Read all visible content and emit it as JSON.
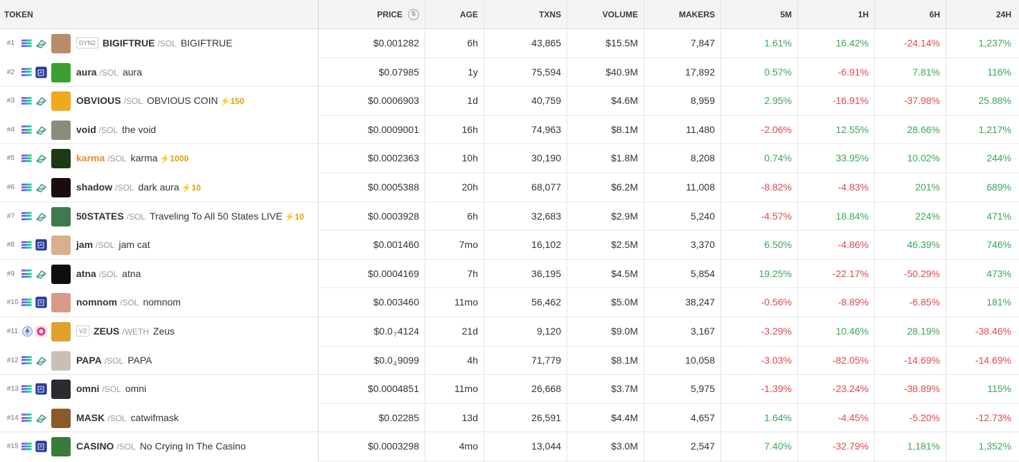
{
  "headers": {
    "token": "TOKEN",
    "price": "PRICE",
    "age": "AGE",
    "txns": "TXNS",
    "volume": "VOLUME",
    "makers": "MAKERS",
    "m5": "5M",
    "h1": "1H",
    "h6": "6H",
    "h24": "24H"
  },
  "price_icon": "dollar-circle-icon",
  "colors": {
    "positive": "#3aa65a",
    "negative": "#e0474c",
    "highlight_symbol": "#f08c23",
    "boost": "#d9a300"
  },
  "rows": [
    {
      "rank": "#1",
      "chain": "solana",
      "dex": "pumpswap",
      "badge": "DYN2",
      "symbol": "BIGIFTRUE",
      "quote": "/SOL",
      "name": "BIGIFTRUE",
      "boost": "",
      "price_pre": "$0.001282",
      "price_sub": "",
      "price_post": "",
      "age": "6h",
      "txns": "43,865",
      "volume": "$15.5M",
      "makers": "7,847",
      "m5": "1.61%",
      "h1": "16.42%",
      "h6": "-24.14%",
      "h24": "1,237%",
      "avatar": "#b98c6b"
    },
    {
      "rank": "#2",
      "chain": "solana",
      "dex": "raydium",
      "badge": "",
      "symbol": "aura",
      "quote": "/SOL",
      "name": "aura",
      "boost": "",
      "price_pre": "$0.07985",
      "price_sub": "",
      "price_post": "",
      "age": "1y",
      "txns": "75,594",
      "volume": "$40.9M",
      "makers": "17,892",
      "m5": "0.57%",
      "h1": "-6.91%",
      "h6": "7.81%",
      "h24": "116%",
      "avatar": "#3aa02f"
    },
    {
      "rank": "#3",
      "chain": "solana",
      "dex": "pumpswap",
      "badge": "",
      "symbol": "OBVIOUS",
      "quote": "/SOL",
      "name": "OBVIOUS COIN",
      "boost": "⚡150",
      "price_pre": "$0.0006903",
      "price_sub": "",
      "price_post": "",
      "age": "1d",
      "txns": "40,759",
      "volume": "$4.6M",
      "makers": "8,959",
      "m5": "2.95%",
      "h1": "-16.91%",
      "h6": "-37.98%",
      "h24": "25.88%",
      "avatar": "#f0a81c"
    },
    {
      "rank": "#4",
      "chain": "solana",
      "dex": "pumpswap",
      "badge": "",
      "symbol": "void",
      "quote": "/SOL",
      "name": "the void",
      "boost": "",
      "price_pre": "$0.0009001",
      "price_sub": "",
      "price_post": "",
      "age": "16h",
      "txns": "74,963",
      "volume": "$8.1M",
      "makers": "11,480",
      "m5": "-2.06%",
      "h1": "12.55%",
      "h6": "28.66%",
      "h24": "1,217%",
      "avatar": "#8c8c7a"
    },
    {
      "rank": "#5",
      "chain": "solana",
      "dex": "pumpswap",
      "badge": "",
      "symbol": "karma",
      "quote": "/SOL",
      "name": "karma",
      "boost": "⚡1000",
      "price_pre": "$0.0002363",
      "price_sub": "",
      "price_post": "",
      "age": "10h",
      "txns": "30,190",
      "volume": "$1.8M",
      "makers": "8,208",
      "m5": "0.74%",
      "h1": "33.95%",
      "h6": "10.02%",
      "h24": "244%",
      "avatar": "#1d3a12",
      "orange": true
    },
    {
      "rank": "#6",
      "chain": "solana",
      "dex": "pumpswap",
      "badge": "",
      "symbol": "shadow",
      "quote": "/SOL",
      "name": "dark aura",
      "boost": "⚡10",
      "price_pre": "$0.0005388",
      "price_sub": "",
      "price_post": "",
      "age": "20h",
      "txns": "68,077",
      "volume": "$6.2M",
      "makers": "11,008",
      "m5": "-8.82%",
      "h1": "-4.83%",
      "h6": "201%",
      "h24": "689%",
      "avatar": "#1a0d0d"
    },
    {
      "rank": "#7",
      "chain": "solana",
      "dex": "pumpswap",
      "badge": "",
      "symbol": "50STATES",
      "quote": "/SOL",
      "name": "Traveling To All 50 States LIVE",
      "boost": "⚡10",
      "price_pre": "$0.0003928",
      "price_sub": "",
      "price_post": "",
      "age": "6h",
      "txns": "32,683",
      "volume": "$2.9M",
      "makers": "5,240",
      "m5": "-4.57%",
      "h1": "18.84%",
      "h6": "224%",
      "h24": "471%",
      "avatar": "#3f7a4a"
    },
    {
      "rank": "#8",
      "chain": "solana",
      "dex": "raydium",
      "badge": "",
      "symbol": "jam",
      "quote": "/SOL",
      "name": "jam cat",
      "boost": "",
      "price_pre": "$0.001460",
      "price_sub": "",
      "price_post": "",
      "age": "7mo",
      "txns": "16,102",
      "volume": "$2.5M",
      "makers": "3,370",
      "m5": "6.50%",
      "h1": "-4.86%",
      "h6": "46.39%",
      "h24": "746%",
      "avatar": "#d9b08c"
    },
    {
      "rank": "#9",
      "chain": "solana",
      "dex": "pumpswap",
      "badge": "",
      "symbol": "atna",
      "quote": "/SOL",
      "name": "atna",
      "boost": "",
      "price_pre": "$0.0004169",
      "price_sub": "",
      "price_post": "",
      "age": "7h",
      "txns": "36,195",
      "volume": "$4.5M",
      "makers": "5,854",
      "m5": "19.25%",
      "h1": "-22.17%",
      "h6": "-50.29%",
      "h24": "473%",
      "avatar": "#0d0d12"
    },
    {
      "rank": "#10",
      "chain": "solana",
      "dex": "raydium",
      "badge": "",
      "symbol": "nomnom",
      "quote": "/SOL",
      "name": "nomnom",
      "boost": "",
      "price_pre": "$0.003460",
      "price_sub": "",
      "price_post": "",
      "age": "11mo",
      "txns": "56,462",
      "volume": "$5.0M",
      "makers": "38,247",
      "m5": "-0.56%",
      "h1": "-8.89%",
      "h6": "-6.85%",
      "h24": "181%",
      "avatar": "#d89a86"
    },
    {
      "rank": "#11",
      "chain": "ethereum",
      "dex": "uniswap",
      "badge": "V2",
      "symbol": "ZEUS",
      "quote": "/WETH",
      "name": "Zeus",
      "boost": "",
      "price_pre": "$0.0",
      "price_sub": "7",
      "price_post": "4124",
      "age": "21d",
      "txns": "9,120",
      "volume": "$9.0M",
      "makers": "3,167",
      "m5": "-3.29%",
      "h1": "10.46%",
      "h6": "28.19%",
      "h24": "-38.46%",
      "avatar": "#e0a030"
    },
    {
      "rank": "#12",
      "chain": "solana",
      "dex": "pumpswap",
      "badge": "",
      "symbol": "PAPA",
      "quote": "/SOL",
      "name": "PAPA",
      "boost": "",
      "price_pre": "$0.0",
      "price_sub": "4",
      "price_post": "9099",
      "age": "4h",
      "txns": "71,779",
      "volume": "$8.1M",
      "makers": "10,058",
      "m5": "-3.03%",
      "h1": "-82.05%",
      "h6": "-14.69%",
      "h24": "-14.69%",
      "avatar": "#c8c0b8"
    },
    {
      "rank": "#13",
      "chain": "solana",
      "dex": "raydium",
      "badge": "",
      "symbol": "omni",
      "quote": "/SOL",
      "name": "omni",
      "boost": "",
      "price_pre": "$0.0004851",
      "price_sub": "",
      "price_post": "",
      "age": "11mo",
      "txns": "26,668",
      "volume": "$3.7M",
      "makers": "5,975",
      "m5": "-1.39%",
      "h1": "-23.24%",
      "h6": "-38.89%",
      "h24": "115%",
      "avatar": "#2a2a30"
    },
    {
      "rank": "#14",
      "chain": "solana",
      "dex": "pumpswap",
      "badge": "",
      "symbol": "MASK",
      "quote": "/SOL",
      "name": "catwifmask",
      "boost": "",
      "price_pre": "$0.02285",
      "price_sub": "",
      "price_post": "",
      "age": "13d",
      "txns": "26,591",
      "volume": "$4.4M",
      "makers": "4,657",
      "m5": "1.64%",
      "h1": "-4.45%",
      "h6": "-5.20%",
      "h24": "-12.73%",
      "avatar": "#8a5a2a"
    },
    {
      "rank": "#15",
      "chain": "solana",
      "dex": "raydium",
      "badge": "",
      "symbol": "CASINO",
      "quote": "/SOL",
      "name": "No Crying In The Casino",
      "boost": "",
      "price_pre": "$0.0003298",
      "price_sub": "",
      "price_post": "",
      "age": "4mo",
      "txns": "13,044",
      "volume": "$3.0M",
      "makers": "2,547",
      "m5": "7.40%",
      "h1": "-32.79%",
      "h6": "1,181%",
      "h24": "1,352%",
      "avatar": "#3a7a3a"
    }
  ]
}
